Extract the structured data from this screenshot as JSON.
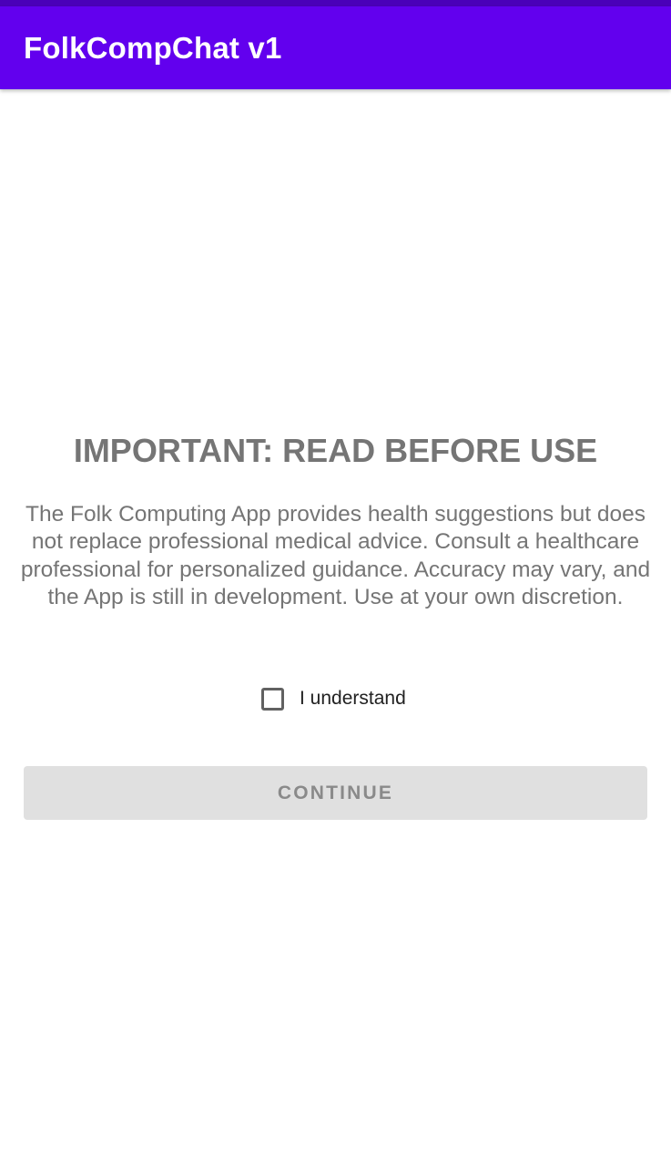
{
  "app_bar": {
    "title": "FolkCompChat v1"
  },
  "disclaimer": {
    "heading": "IMPORTANT: READ BEFORE USE",
    "body": "The Folk Computing App provides health suggestions but does not replace professional medical advice. Consult a healthcare professional for personalized guidance. Accuracy may vary, and the App is still in development. Use at your own discretion."
  },
  "acknowledge": {
    "label": "I understand",
    "checked": false
  },
  "continue_button": {
    "label": "CONTINUE",
    "enabled": false
  },
  "colors": {
    "app_bar": "#6200ee",
    "status_bar": "#4a00b8",
    "heading_text": "#757575",
    "button_disabled_bg": "#e0e0e0",
    "button_disabled_text": "#8a8a8a"
  }
}
